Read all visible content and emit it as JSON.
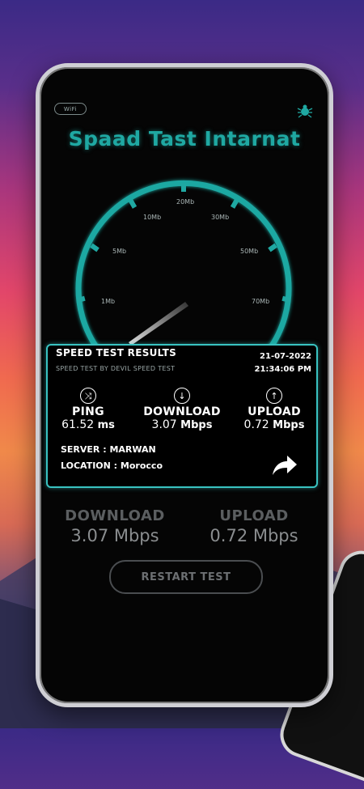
{
  "status": {
    "wifi_label": "WiFi"
  },
  "app": {
    "title": "Spaad Tast Intarnat"
  },
  "gauge": {
    "labels": [
      "1Mb",
      "5Mb",
      "10Mb",
      "20Mb",
      "30Mb",
      "50Mb",
      "70Mb"
    ],
    "accent": "#1fa8a2"
  },
  "results": {
    "title": "SPEED TEST RESULTS",
    "subtitle": "SPEED TEST BY DEVIL SPEED TEST",
    "date": "21-07-2022",
    "time": "21:34:06 PM",
    "ping": {
      "label": "PING",
      "value": "61.52",
      "unit": "ms"
    },
    "download": {
      "label": "DOWNLOAD",
      "value": "3.07",
      "unit": "Mbps"
    },
    "upload": {
      "label": "UPLOAD",
      "value": "0.72",
      "unit": "Mbps"
    },
    "server": "SERVER : MARWAN",
    "location": "LOCATION : Morocco"
  },
  "summary": {
    "download_label": "DOWNLOAD",
    "download_value": "3.07 Mbps",
    "upload_label": "UPLOAD",
    "upload_value": "0.72 Mbps"
  },
  "restart_label": "RESTART TEST"
}
